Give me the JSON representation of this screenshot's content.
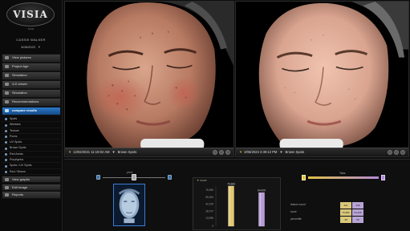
{
  "app": {
    "logo": "VISIA",
    "logo_sub": "Smile",
    "patient_name": "CASSIE WALKER",
    "patient_date": "3/06/2023"
  },
  "sidebar": {
    "items": [
      {
        "label": "View pictures"
      },
      {
        "label": "Project Age"
      },
      {
        "label": "Simulation"
      },
      {
        "label": "3-D viewer"
      },
      {
        "label": "Simulation"
      },
      {
        "label": "Recommendations"
      }
    ],
    "active": {
      "label": "compare results"
    },
    "sub_items": [
      {
        "label": "Spots"
      },
      {
        "label": "Wrinkles"
      },
      {
        "label": "Texture"
      },
      {
        "label": "Pores"
      },
      {
        "label": "UV Spots"
      },
      {
        "label": "Brown Spots"
      },
      {
        "label": "Red Areas"
      },
      {
        "label": "Porphyrins"
      },
      {
        "label": "Spots / UV Spots"
      },
      {
        "label": "Red / Brown"
      }
    ],
    "bottom_items": [
      {
        "label": "View graphs"
      },
      {
        "label": "Edit Image"
      },
      {
        "label": "Reports"
      }
    ]
  },
  "left_panel": {
    "date": "12/02/2021 11:19:02 AM",
    "mode": "Brown Spots"
  },
  "right_panel": {
    "date": "3/06/2023 2:39:12 PM",
    "mode": "Brown Spots"
  },
  "bottom": {
    "pixel_label": "pixel",
    "tabs_label": "Tabs",
    "chart_title_prefix": "",
    "chart_title": "score",
    "stats": [
      {
        "label": "feature count",
        "v1": "421",
        "v2": "336"
      },
      {
        "label": "score",
        "v1": "76,983",
        "v2": "64,429"
      },
      {
        "label": "percentile",
        "v1": "48",
        "v2": "56"
      }
    ]
  },
  "chart_data": {
    "type": "bar",
    "categories": [
      "12/02/2021",
      "3/06/2023"
    ],
    "values": [
      76983,
      64429
    ],
    "ylim": [
      0,
      76983
    ],
    "yticks": [
      0,
      15396,
      28792,
      42188,
      55584,
      68980
    ],
    "ytick_labels": [
      "0",
      "13,996",
      "28,797",
      "42,195",
      "55,394",
      "76,983"
    ],
    "data_labels": [
      "76,983",
      "64,429"
    ],
    "colors": [
      "#e3c76a",
      "#b89ad8"
    ],
    "grid": false
  },
  "colors": {
    "accent": "#2a79c9",
    "caption_arrow": "#d8a24a"
  }
}
